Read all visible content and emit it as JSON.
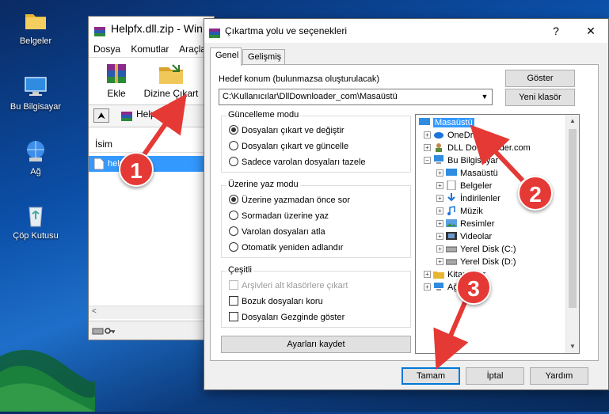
{
  "desktop": {
    "icons": [
      {
        "label": "Belgeler",
        "icon": "documents-folder-icon"
      },
      {
        "label": "Bu Bilgisayar",
        "icon": "computer-icon"
      },
      {
        "label": "Ağ",
        "icon": "network-icon"
      },
      {
        "label": "Çöp Kutusu",
        "icon": "recycle-bin-icon"
      }
    ]
  },
  "winrar": {
    "title": "Helpfx.dll.zip - WinRAR",
    "menu": [
      "Dosya",
      "Komutlar",
      "Araçla"
    ],
    "toolbar": {
      "add_label": "Ekle",
      "extract_label": "Dizine Çıkart"
    },
    "address": "Helpfx.dll.z",
    "list_header": "İsim",
    "list_row": "helpfx.dll"
  },
  "dialog": {
    "title": "Çıkartma yolu ve seçenekleri",
    "help_button": "?",
    "close_button": "✕",
    "tabs": [
      "Genel",
      "Gelişmiş"
    ],
    "dest_label": "Hedef konum (bulunmazsa oluşturulacak)",
    "dest_value": "C:\\Kullanıcılar\\DllDownloader_com\\Masaüstü",
    "show_button": "Göster",
    "new_folder_button": "Yeni klasör",
    "update_mode": {
      "title": "Güncelleme modu",
      "options": [
        "Dosyaları çıkart ve değiştir",
        "Dosyaları çıkart ve güncelle",
        "Sadece varolan dosyaları tazele"
      ],
      "selected": 0
    },
    "overwrite_mode": {
      "title": "Üzerine yaz modu",
      "options": [
        "Üzerine yazmadan önce sor",
        "Sormadan üzerine yaz",
        "Varolan dosyaları atla",
        "Otomatik yeniden adlandır"
      ],
      "selected": 0
    },
    "misc": {
      "title": "Çeşitli",
      "options": [
        "Arşivleri alt klasörlere çıkart",
        "Bozuk dosyaları koru",
        "Dosyaları Gezginde göster"
      ]
    },
    "save_settings_button": "Ayarları kaydet",
    "tree": [
      "Masaüstü",
      "OneDrive",
      "DLL Downloader.com",
      "Bu Bilgisayar",
      "Masaüstü",
      "Belgeler",
      "İndirilenler",
      "Müzik",
      "Resimler",
      "Videolar",
      "Yerel Disk (C:)",
      "Yerel Disk (D:)",
      "Kitaplıklar",
      "Ağ"
    ],
    "ok_button": "Tamam",
    "cancel_button": "İptal",
    "help_button_bottom": "Yardım"
  },
  "annotations": [
    "1",
    "2",
    "3"
  ],
  "colors": {
    "annotation": "#e53935",
    "selection": "#3399ff",
    "default_button_border": "#0078d7"
  }
}
